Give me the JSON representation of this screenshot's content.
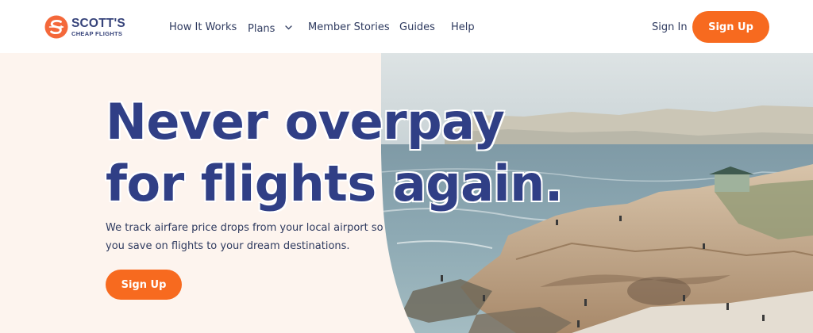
{
  "brand": {
    "name_main": "SCOTT'S",
    "name_sub": "CHEAP FLIGHTS",
    "color": "#f4683a",
    "text_color": "#36437a"
  },
  "nav": {
    "items": [
      {
        "label": "How It Works"
      },
      {
        "label": "Plans",
        "has_dropdown": true
      },
      {
        "label": "Member Stories"
      },
      {
        "label": "Guides"
      },
      {
        "label": "Help"
      }
    ],
    "sign_in": "Sign In",
    "sign_up": "Sign Up"
  },
  "hero": {
    "headline_line1": "Never overpay",
    "headline_line2": "for flights again.",
    "subtext_line1": "We track airfare price drops from your local airport so",
    "subtext_line2": "you save on flights to your dream destinations.",
    "cta": "Sign Up",
    "image_description": "coastal cliffs with ocean and beachgoers"
  },
  "colors": {
    "accent": "#f76a1f",
    "headline": "#303f86",
    "hero_bg": "#fdf4ee"
  }
}
